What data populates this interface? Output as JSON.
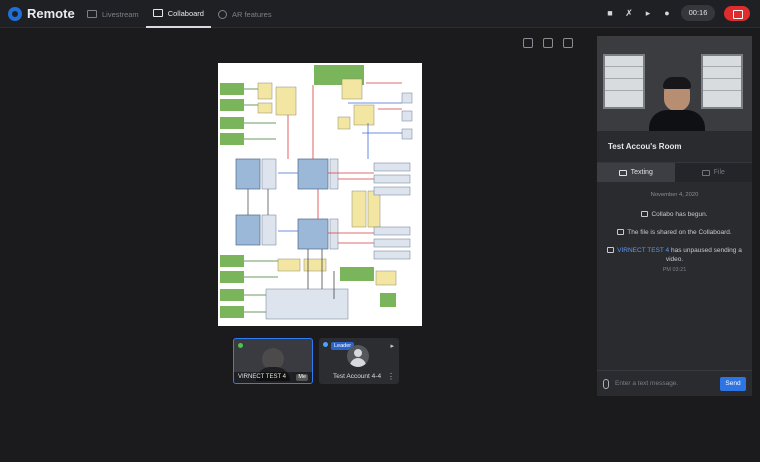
{
  "app": {
    "title": "Remote",
    "brand_color": "#1f6fd6"
  },
  "nav": [
    {
      "label": "Livestream",
      "icon": "livestream-icon",
      "active": false
    },
    {
      "label": "Collaboard",
      "icon": "collaboard-icon",
      "active": true
    },
    {
      "label": "AR features",
      "icon": "ar-features-icon",
      "active": false
    }
  ],
  "controls": {
    "timer": "00:16",
    "icons": [
      "camera-icon",
      "mic-muted-icon",
      "speaker-icon",
      "notification-icon"
    ],
    "end_color": "#e02c2c"
  },
  "stage": {
    "tools": [
      "capture-icon",
      "share-icon",
      "settings-icon"
    ]
  },
  "participants": [
    {
      "name": "VIRNECT TEST 4",
      "me_label": "Me",
      "status_color": "#4ac44a"
    },
    {
      "name": "Test Account 4-4",
      "role": "Leader",
      "status_color": "#4da3ff"
    }
  ],
  "panel": {
    "room_title": "Test Accou's Room",
    "tabs": [
      {
        "label": "Texting",
        "active": true
      },
      {
        "label": "File",
        "active": false
      }
    ],
    "chat": {
      "date": "November 4, 2020",
      "messages": [
        {
          "icon": "collabo-icon",
          "text": "Collabo has begun."
        },
        {
          "icon": "pen-icon",
          "text": "The  file is shared on the Collaboard."
        },
        {
          "icon": "bell-icon",
          "user": "VIRNECT TEST 4",
          "text": " has unpaused sending a video.",
          "time": "PM 03:21"
        }
      ]
    },
    "composer": {
      "placeholder": "Enter a text message.",
      "send_label": "Send"
    }
  }
}
